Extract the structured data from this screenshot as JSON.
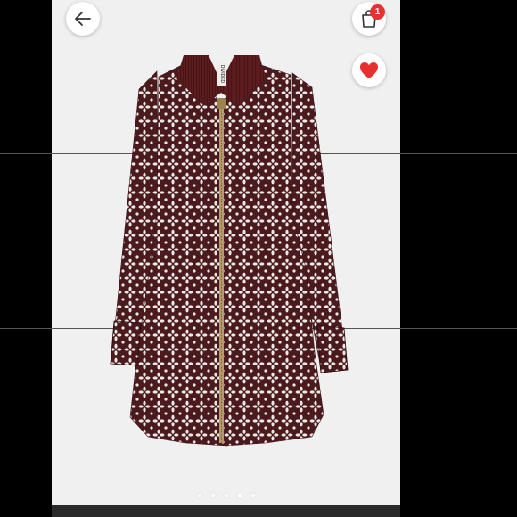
{
  "header": {
    "back_icon": "arrow-left-icon",
    "bag_icon": "shopping-bag-icon",
    "bag_count": "1",
    "like_icon": "heart-icon"
  },
  "product_image": {
    "brand_tag": "DIVIDED",
    "pattern_colors": {
      "base": "#4a1a1e",
      "flower": "#ece8e4",
      "collar": "#5a1c1e",
      "zipper": "#b59a6a"
    }
  },
  "carousel": {
    "total_slides": 5,
    "active_index": 3
  },
  "colors": {
    "badge": "#e8302f",
    "heart": "#e8302f"
  }
}
